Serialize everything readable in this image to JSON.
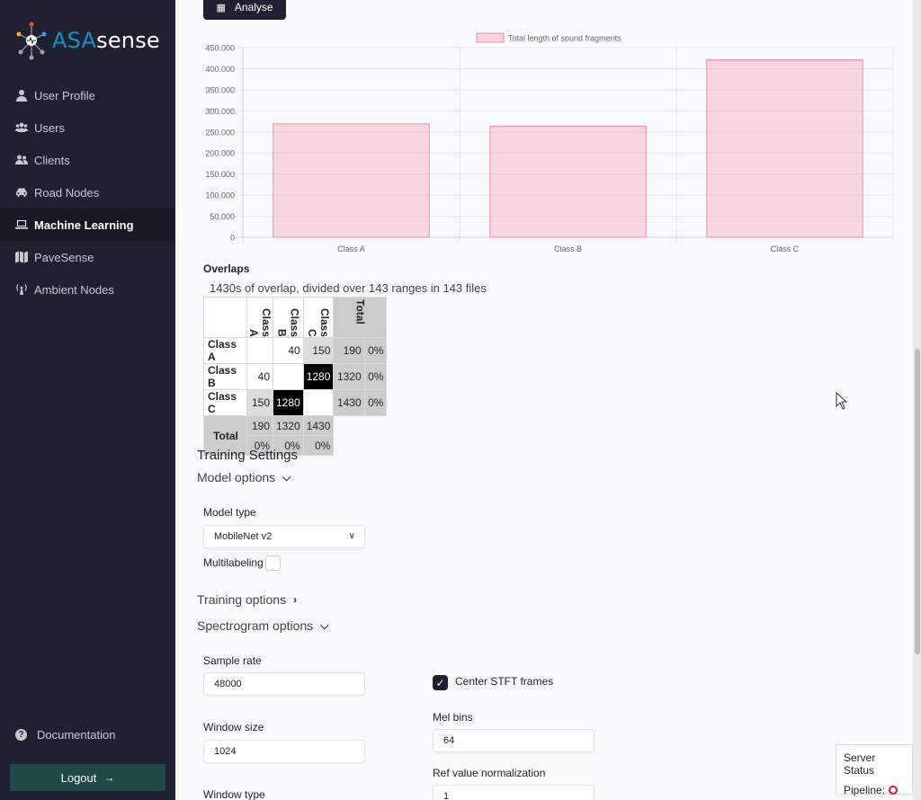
{
  "sidebar": {
    "logo": {
      "part1": "ASA",
      "part2": "sense"
    },
    "items": [
      {
        "label": "User Profile",
        "icon": "user-icon"
      },
      {
        "label": "Users",
        "icon": "users-icon"
      },
      {
        "label": "Clients",
        "icon": "clients-icon"
      },
      {
        "label": "Road Nodes",
        "icon": "car-icon"
      },
      {
        "label": "Machine Learning",
        "icon": "laptop-icon",
        "active": true
      },
      {
        "label": "PaveSense",
        "icon": "map-icon"
      },
      {
        "label": "Ambient Nodes",
        "icon": "antenna-icon"
      }
    ],
    "documentation": "Documentation",
    "logout": "Logout"
  },
  "toolbar": {
    "analyse_label": "Analyse"
  },
  "chart_data": {
    "type": "bar",
    "categories": [
      "Class A",
      "Class B",
      "Class C"
    ],
    "series": [
      {
        "name": "Total length of sound fragments",
        "values": [
          269000,
          264000,
          421000
        ],
        "color": "#f4a3b6"
      }
    ],
    "yticks": [
      "450.000",
      "400.000",
      "350.000",
      "300.000",
      "250.000",
      "200.000",
      "150.000",
      "100.000",
      "50.000",
      "0"
    ],
    "ylim": [
      0,
      450000
    ],
    "legend": "top-center",
    "grid": true
  },
  "overlaps": {
    "title": "Overlaps",
    "description": "1430s of overlap, divided over 143 ranges in 143 files",
    "columns": [
      "Class A",
      "Class B",
      "Class C",
      "Total"
    ],
    "rows": [
      {
        "label": "Class A",
        "cells": [
          "",
          "40",
          "150"
        ],
        "total": "190",
        "pct": "0%"
      },
      {
        "label": "Class B",
        "cells": [
          "40",
          "",
          "1280"
        ],
        "total": "1320",
        "pct": "0%"
      },
      {
        "label": "Class C",
        "cells": [
          "150",
          "1280",
          ""
        ],
        "total": "1430",
        "pct": "0%"
      }
    ],
    "total_row": {
      "label": "Total",
      "values": [
        "190",
        "1320",
        "1430"
      ],
      "pcts": [
        "0%",
        "0%",
        "0%"
      ]
    }
  },
  "training": {
    "title": "Training Settings",
    "model_options": "Model options",
    "model_type_label": "Model type",
    "model_type_value": "MobileNet v2",
    "multilabeling_label": "Multilabeling",
    "training_options": "Training options",
    "spectrogram_options": "Spectrogram options",
    "sample_rate_label": "Sample rate",
    "sample_rate_value": "48000",
    "center_stft_label": "Center STFT frames",
    "window_size_label": "Window size",
    "window_size_value": "1024",
    "mel_bins_label": "Mel bins",
    "mel_bins_value": "64",
    "ref_value_label": "Ref value normalization",
    "ref_value_value": "1",
    "window_type_label": "Window type"
  },
  "server_status": {
    "title": "Server Status",
    "pipeline_label": "Pipeline:"
  }
}
